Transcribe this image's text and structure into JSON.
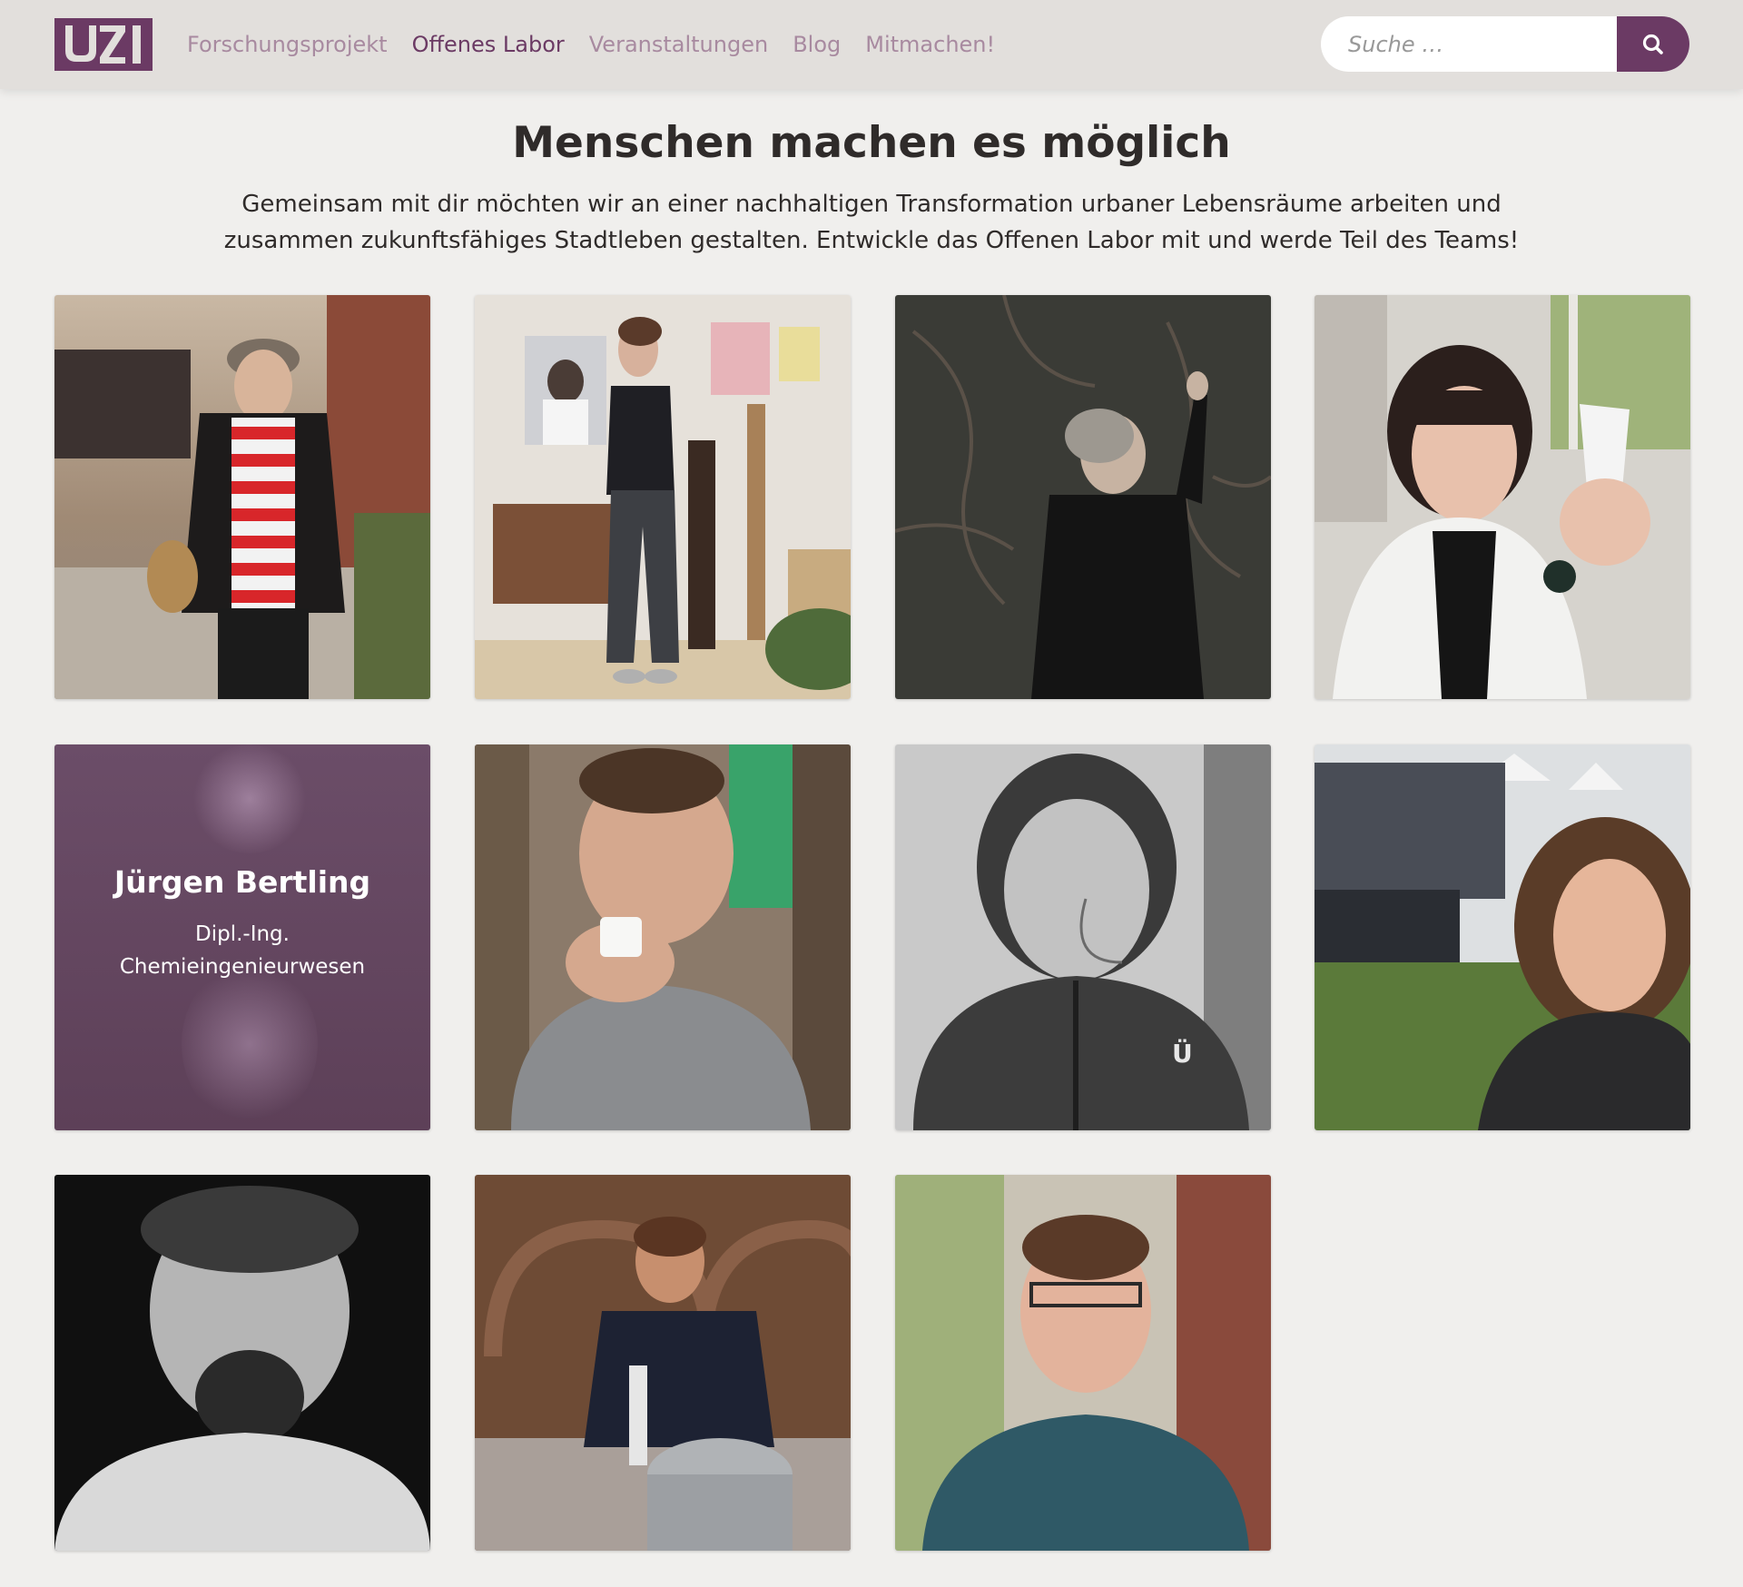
{
  "header": {
    "logo_text": "UZI",
    "nav": [
      {
        "label": "Forschungsprojekt",
        "active": false
      },
      {
        "label": "Offenes Labor",
        "active": true
      },
      {
        "label": "Veranstaltungen",
        "active": false
      },
      {
        "label": "Blog",
        "active": false
      },
      {
        "label": "Mitmachen!",
        "active": false
      }
    ],
    "search": {
      "placeholder": "Suche …",
      "icon": "search-icon"
    }
  },
  "main": {
    "title": "Menschen machen es möglich",
    "intro": "Gemeinsam mit dir möchten wir an einer nachhaltigen Transformation urbaner Lebensräume arbeiten und zusammen zukunftsfähiges Stadtleben gestalten. Entwickle das Offenen Labor mit und werde Teil des Teams!"
  },
  "team": {
    "hover_card": {
      "name": "Jürgen Bertling",
      "role_line1": "Dipl.-Ing.",
      "role_line2": "Chemieingenieurwesen"
    }
  },
  "colors": {
    "brand": "#6b3a64",
    "nav_inactive": "#a88aa0",
    "header_bg": "#e2dfdc",
    "page_bg": "#f0efed"
  }
}
